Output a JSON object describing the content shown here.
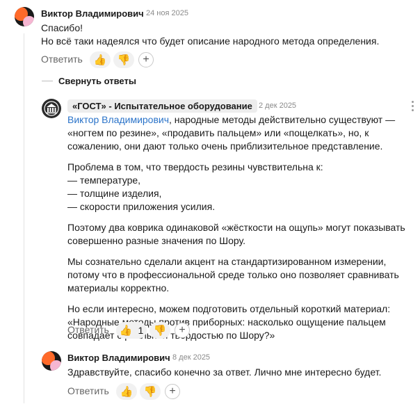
{
  "comment1": {
    "author": "Виктор Владимирович",
    "date": "24 ноя 2025",
    "lines": [
      "Спасибо!",
      "Но всё таки надеялся что будет описание народного метода определения."
    ],
    "reply_label": "Ответить",
    "plus_label": "+"
  },
  "collapse": {
    "label": "Свернуть ответы"
  },
  "reply1": {
    "author": "«ГОСТ» - Испытательное оборудование",
    "date": "2 дек 2025",
    "mention": "Виктор Владимирович",
    "p1_rest": ", народные методы действительно существуют — «ногтем по резине», «продавить пальцем» или «пощелкать», но, к сожалению, они дают только очень приблизительное представление.",
    "p2_lines": [
      "Проблема в том, что твердость резины чувствительна к:",
      "— температуре,",
      "— толщине изделия,",
      "— скорости приложения усилия."
    ],
    "p3": "Поэтому два коврика одинаковой «жёсткости на ощупь» могут показывать совершенно разные значения по Шору.",
    "p4": "Мы сознательно сделали акцент на стандартизированном измерении, потому что в профессиональной среде только оно позволяет сравнивать материалы корректно.",
    "p5": "Но если интересно, можем подготовить отдельный короткий материал: «Народные методы против приборных: насколько ощущение пальцем совпадает с реальной твердостью по Шору?»",
    "reply_label": "Ответить",
    "like_count": "1",
    "plus_label": "+"
  },
  "reply2": {
    "author": "Виктор Владимирович",
    "date": "8 дек 2025",
    "text": "Здравствуйте, спасибо конечно за ответ. Лично мне интересно будет.",
    "reply_label": "Ответить",
    "plus_label": "+"
  },
  "icons": {
    "like": "👍",
    "dislike": "👎",
    "avatar_user": "user-avatar-icon",
    "avatar_company": "gost-logo-icon",
    "more": "more-vertical-icon"
  }
}
